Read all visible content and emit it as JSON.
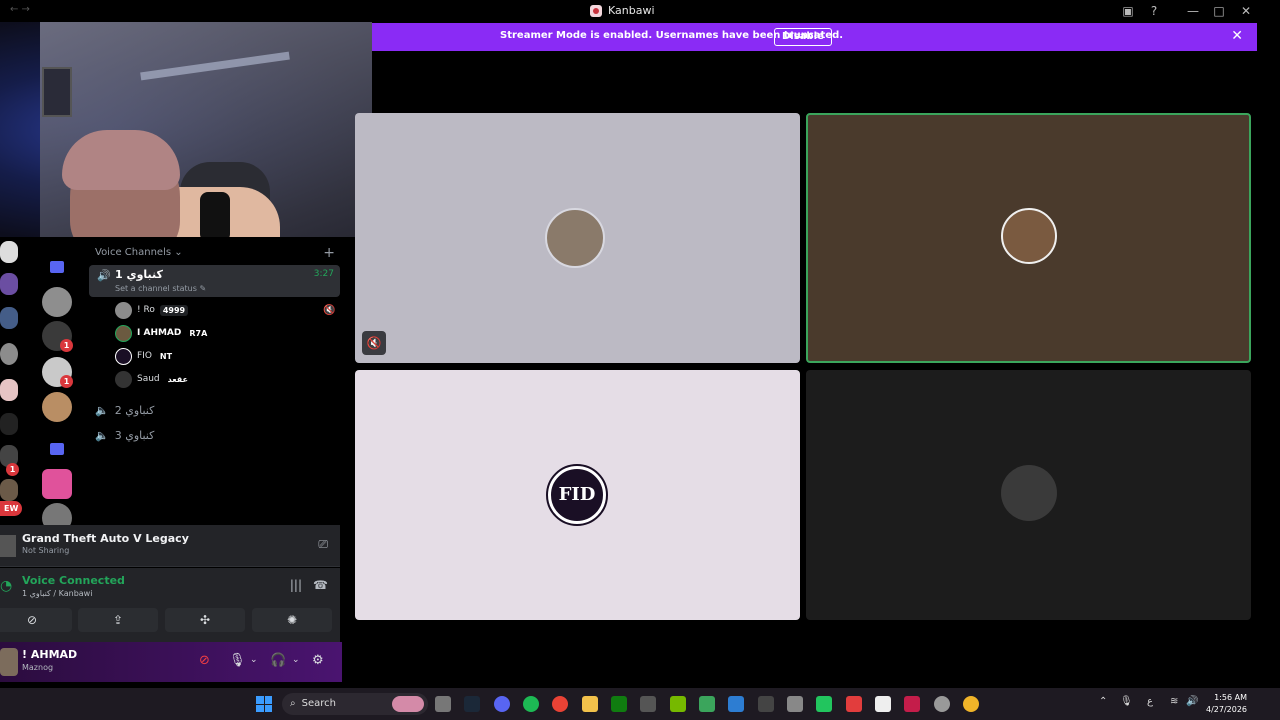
{
  "window": {
    "title": "Kanbawi"
  },
  "banner": {
    "message": "Streamer Mode is enabled. Usernames have been truncated.",
    "button": "Disable"
  },
  "voice_channels": {
    "header": "Voice Channels",
    "active": {
      "name": "1 كنباوي",
      "timer": "3:27",
      "status": "Set a channel status"
    },
    "members": [
      {
        "name": "! Ro",
        "tag": "4999"
      },
      {
        "name": "I AHMAD",
        "tag": "R7A"
      },
      {
        "name": "FIO",
        "tag": "NT"
      },
      {
        "name": "Saud",
        "tag": "عقعد"
      }
    ],
    "other": [
      "2 كنباوي",
      "3 كنباوي"
    ]
  },
  "dm_badges": [
    "1",
    "1",
    "1"
  ],
  "new_badge": "EW",
  "activity": {
    "title": "Grand Theft Auto V Legacy",
    "sub": "Not Sharing"
  },
  "voice": {
    "status": "Voice Connected",
    "path": "1 كنباوي / Kanbawi"
  },
  "user": {
    "name": "! AHMAD",
    "status": "Maznog"
  },
  "tiles": {
    "fid_text": "FID"
  },
  "taskbar": {
    "search": "Search",
    "lang": "ع",
    "time": "1:56 AM",
    "date": "4/27/2026"
  },
  "colors": {
    "accent_banner": "#8a2bf5",
    "connected": "#23a55a",
    "speaking_border": "#3ba55c"
  }
}
